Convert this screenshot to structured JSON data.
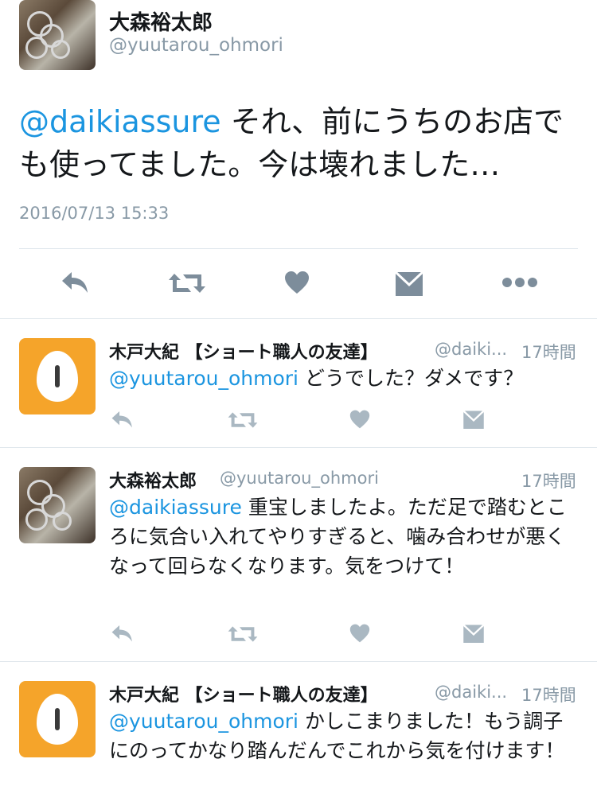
{
  "main_tweet": {
    "display_name": "大森裕太郎",
    "handle": "@yuutarou_ohmori",
    "mention": "@daikiassure",
    "text": " それ、前にうちのお店でも使ってました。今は壊れました…",
    "timestamp": "2016/07/13 15:33",
    "actions": [
      "reply-icon",
      "retweet-icon",
      "like-icon",
      "dm-icon",
      "more-icon"
    ]
  },
  "replies": [
    {
      "display_name": "木戸大紀 【ショート職人の友達】",
      "handle": "@daiki...",
      "time": "17時間",
      "mention": "@yuutarou_ohmori",
      "text": " どうでした？ダメです？",
      "avatar": "egg-avatar"
    },
    {
      "display_name": "大森裕太郎",
      "handle": "@yuutarou_ohmori",
      "time": "17時間",
      "mention": "@daikiassure",
      "text": " 重宝しましたよ。ただ足で踏むところに気合い入れてやりすぎると、噛み合わせが悪くなって回らなくなります。気をつけて！",
      "avatar": "photo-avatar"
    },
    {
      "display_name": "木戸大紀 【ショート職人の友達】",
      "handle": "@daiki...",
      "time": "17時間",
      "mention": "@yuutarou_ohmori",
      "text": " かしこまりました！もう調子にのってかなり踏んだんでこれから気を付けます！",
      "avatar": "egg-avatar"
    }
  ],
  "colors": {
    "link": "#1b95e0",
    "secondary_text": "#8899a6",
    "icon": "#7d8d9b",
    "reply_icon": "#aab8c2",
    "divider": "#e1e8ed",
    "avatar_bg": "#f5a42a"
  }
}
